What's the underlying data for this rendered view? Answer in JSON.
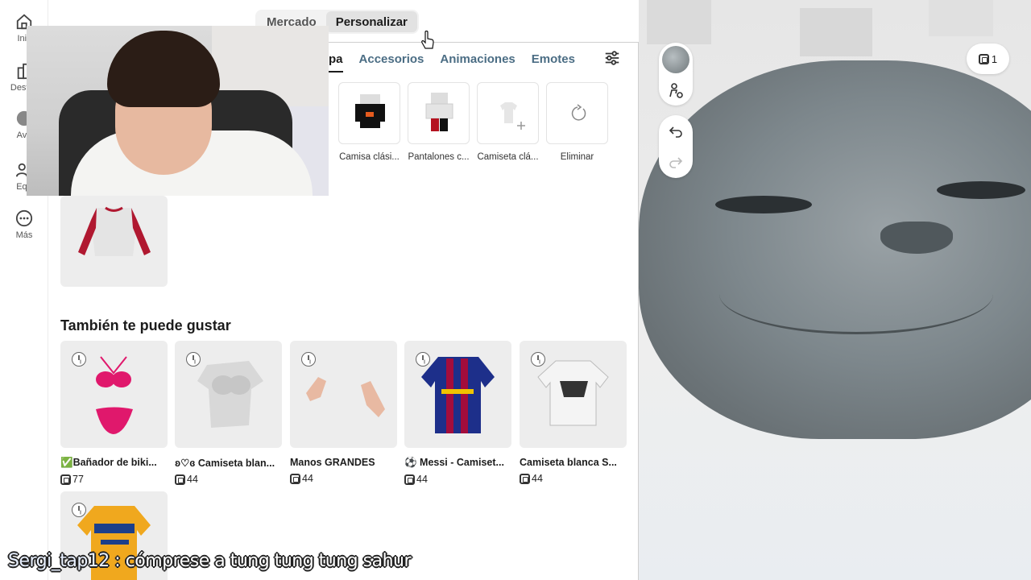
{
  "rail": {
    "items": [
      {
        "label": "Inic",
        "icon": "home-icon"
      },
      {
        "label": "Destac",
        "icon": "charts-icon"
      },
      {
        "label": "Ava",
        "icon": "avatar-icon"
      },
      {
        "label": "Equ",
        "icon": "groups-icon"
      },
      {
        "label": "Más",
        "icon": "more-icon"
      }
    ]
  },
  "top_tabs": {
    "marketplace": "Mercado",
    "customize": "Personalizar",
    "active": "Personalizar"
  },
  "sub_tabs": {
    "clothing": "pa",
    "accessories": "Accesorios",
    "animations": "Animaciones",
    "emotes": "Emotes"
  },
  "worn": [
    {
      "label": "Camisa clási...",
      "icon": "classic-shirt-icon"
    },
    {
      "label": "Pantalones c...",
      "icon": "classic-pants-icon"
    },
    {
      "label": "Camiseta clá...",
      "icon": "add-tshirt-icon"
    },
    {
      "label": "Eliminar",
      "icon": "reset-icon"
    }
  ],
  "recommendations": {
    "title": "También te puede gustar",
    "items": [
      {
        "name": "✅Bañador de biki...",
        "price": "77",
        "icon": "bikini-icon"
      },
      {
        "name": "ʚ♡ɞ Camiseta blan...",
        "price": "44",
        "icon": "white-torso-icon"
      },
      {
        "name": "Manos GRANDES",
        "price": "44",
        "icon": "hands-icon"
      },
      {
        "name": "⚽ Messi - Camiset...",
        "price": "44",
        "icon": "jersey-icon"
      },
      {
        "name": "Camiseta blanca S...",
        "price": "44",
        "icon": "white-tshirt-icon"
      },
      {
        "name": "",
        "price": "",
        "icon": "tigres-jersey-icon"
      }
    ]
  },
  "viewport": {
    "robux_balance": "1"
  },
  "caption": {
    "user": "Sergi_tap12",
    "text": " : cómprese a tung tung tung sahur"
  }
}
